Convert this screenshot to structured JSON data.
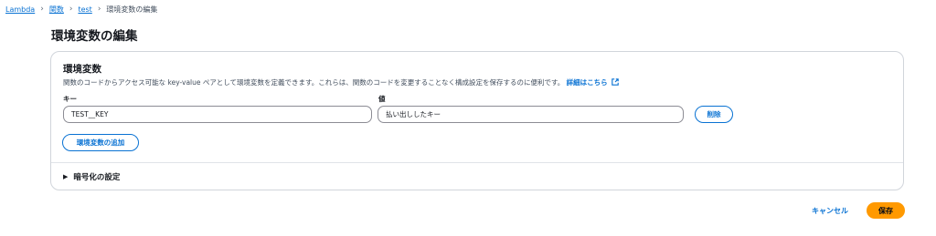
{
  "breadcrumb": {
    "items": [
      {
        "label": "Lambda"
      },
      {
        "label": "関数"
      },
      {
        "label": "test"
      }
    ],
    "current": "環境変数の編集"
  },
  "page": {
    "title": "環境変数の編集"
  },
  "panel": {
    "title": "環境変数",
    "description": "関数のコードからアクセス可能な key-value ペアとして環境変数を定義できます。これらは、関数のコードを変更することなく構成設定を保存するのに便利です。",
    "learn_more": "詳細はこちら",
    "key_label": "キー",
    "value_label": "値",
    "env_vars": [
      {
        "key": "TEST__KEY",
        "value": "払い出ししたキー"
      }
    ],
    "remove_label": "削除",
    "add_label": "環境変数の追加",
    "encryption_label": "暗号化の設定"
  },
  "actions": {
    "cancel_label": "キャンセル",
    "save_label": "保存"
  },
  "colors": {
    "link": "#0972d3",
    "primary": "#ff9900",
    "border": "#d1d5db"
  }
}
